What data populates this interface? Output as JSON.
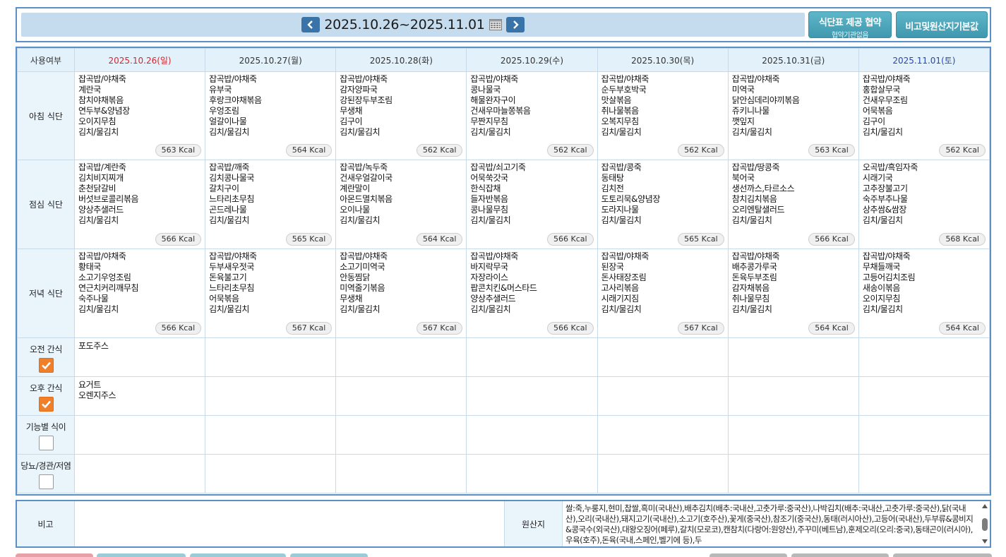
{
  "header": {
    "date_range": "2025.10.26~2025.11.01",
    "prev_label": "previous-week",
    "next_label": "next-week",
    "btn_agreement_main": "식단표 제공 협약",
    "btn_agreement_sub": "협약기관없음",
    "btn_defaults": "비고및원산지기본값"
  },
  "table": {
    "corner_label": "사용여부",
    "days": [
      {
        "label": "2025.10.26(일)",
        "type": "sun"
      },
      {
        "label": "2025.10.27(월)",
        "type": "weekday"
      },
      {
        "label": "2025.10.28(화)",
        "type": "weekday"
      },
      {
        "label": "2025.10.29(수)",
        "type": "weekday"
      },
      {
        "label": "2025.10.30(목)",
        "type": "weekday"
      },
      {
        "label": "2025.10.31(금)",
        "type": "weekday"
      },
      {
        "label": "2025.11.01(토)",
        "type": "sat"
      }
    ],
    "meals": [
      {
        "label": "아침 식단",
        "cells": [
          {
            "items": [
              "잡곡밥/야채죽",
              "계란국",
              "참치야채볶음",
              "연두부&양념장",
              "오이지무침",
              "김치/물김치"
            ],
            "kcal": "563 Kcal"
          },
          {
            "items": [
              "잡곡밥/야채죽",
              "유부국",
              "후랑크야채볶음",
              "우엉조림",
              "얼갈이나물",
              "김치/물김치"
            ],
            "kcal": "564 Kcal"
          },
          {
            "items": [
              "잡곡밥/야채죽",
              "감자양파국",
              "강된장두부조림",
              "무생채",
              "김구이",
              "김치/물김치"
            ],
            "kcal": "562 Kcal"
          },
          {
            "items": [
              "잡곡밥/야채죽",
              "콩나물국",
              "해물완자구이",
              "건새우마늘쫑볶음",
              "무짠지무침",
              "김치/물김치"
            ],
            "kcal": "562 Kcal"
          },
          {
            "items": [
              "잡곡밥/야채죽",
              "순두부호박국",
              "맛살볶음",
              "취나물볶음",
              "오복지무침",
              "김치/물김치"
            ],
            "kcal": "562 Kcal"
          },
          {
            "items": [
              "잡곡밥/야채죽",
              "미역국",
              "닭안심데리야끼볶음",
              "쥬키니나물",
              "깻잎지",
              "김치/물김치"
            ],
            "kcal": "563 Kcal"
          },
          {
            "items": [
              "잡곡밥/야채죽",
              "홍합살무국",
              "건새우무조림",
              "어묵볶음",
              "김구이",
              "김치/물김치"
            ],
            "kcal": "562 Kcal"
          }
        ]
      },
      {
        "label": "점심 식단",
        "cells": [
          {
            "items": [
              "잡곡밥/계란죽",
              "김치비지찌개",
              "춘천닭갈비",
              "버섯브로콜리볶음",
              "양상추샐러드",
              "김치/물김치"
            ],
            "kcal": "566 Kcal"
          },
          {
            "items": [
              "잡곡밥/깨죽",
              "김치콩나물국",
              "갈치구이",
              "느타리초무침",
              "곤드레나물",
              "김치/물김치"
            ],
            "kcal": "565 Kcal"
          },
          {
            "items": [
              "잡곡밥/녹두죽",
              "건새우얼갈이국",
              "계란말이",
              "아몬드멸치볶음",
              "오이나물",
              "김치/물김치"
            ],
            "kcal": "564 Kcal"
          },
          {
            "items": [
              "잡곡밥/쇠고기죽",
              "어묵쑥갓국",
              "한식잡채",
              "들자반볶음",
              "콩나물무침",
              "김치/물김치"
            ],
            "kcal": "566 Kcal"
          },
          {
            "items": [
              "잡곡밥/콩죽",
              "동태탕",
              "김치전",
              "도토리묵&양념장",
              "도라지나물",
              "김치/물김치"
            ],
            "kcal": "565 Kcal"
          },
          {
            "items": [
              "잡곡밥/땅콩죽",
              "북어국",
              "생선까스,타르소스",
              "참치김치볶음",
              "오리엔탈샐러드",
              "김치/물김치"
            ],
            "kcal": "566 Kcal"
          },
          {
            "items": [
              "오곡밥/흑임자죽",
              "시래기국",
              "고추장불고기",
              "숙주부추나물",
              "상추쌈&쌈장",
              "김치/물김치"
            ],
            "kcal": "568 Kcal"
          }
        ]
      },
      {
        "label": "저녁 식단",
        "cells": [
          {
            "items": [
              "잡곡밥/야채죽",
              "황태국",
              "소고기우엉조림",
              "연근치커리깨무침",
              "숙주나물",
              "김치/물김치"
            ],
            "kcal": "566 Kcal"
          },
          {
            "items": [
              "잡곡밥/야채죽",
              "두부새우젓국",
              "돈육불고기",
              "느타리초무침",
              "어묵볶음",
              "김치/물김치"
            ],
            "kcal": "567 Kcal"
          },
          {
            "items": [
              "잡곡밥/야채죽",
              "소고기미역국",
              "안동찜닭",
              "미역줄기볶음",
              "무생채",
              "김치/물김치"
            ],
            "kcal": "567 Kcal"
          },
          {
            "items": [
              "잡곡밥/야채죽",
              "바지락무국",
              "자장라이스",
              "팝콘치킨&머스타드",
              "양상추샐러드",
              "김치/물김치"
            ],
            "kcal": "566 Kcal"
          },
          {
            "items": [
              "잡곡밥/야채죽",
              "된장국",
              "돈사태장조림",
              "고사리볶음",
              "시래기지짐",
              "김치/물김치"
            ],
            "kcal": "567 Kcal"
          },
          {
            "items": [
              "잡곡밥/야채죽",
              "배추콩가루국",
              "돈육두부조림",
              "감자채볶음",
              "취나물무침",
              "김치/물김치"
            ],
            "kcal": "564 Kcal"
          },
          {
            "items": [
              "잡곡밥/야채죽",
              "무채들깨국",
              "고등어김치조림",
              "새송이볶음",
              "오이지무침",
              "김치/물김치"
            ],
            "kcal": "564 Kcal"
          }
        ]
      }
    ],
    "snacks": [
      {
        "label": "오전 간식",
        "checked": true,
        "cells": [
          [
            "포도주스"
          ],
          [],
          [],
          [],
          [],
          [],
          []
        ]
      },
      {
        "label": "오후 간식",
        "checked": true,
        "cells": [
          [
            "요거트",
            "오렌지주스"
          ],
          [],
          [],
          [],
          [],
          [],
          []
        ]
      },
      {
        "label": "기능별 식이",
        "checked": false,
        "cells": [
          [],
          [],
          [],
          [],
          [],
          [],
          []
        ]
      },
      {
        "label": "당뇨/경관/저염",
        "checked": false,
        "cells": [
          [],
          [],
          [],
          [],
          [],
          [],
          []
        ]
      }
    ]
  },
  "notes": {
    "remarks_label": "비고",
    "remarks_value": "",
    "origin_label": "원산지",
    "origin_text": "쌀:죽,누룽지,현미,찹쌀,흑미(국내산),배추김치(배추:국내산,고춧가루:중국산),나박김치(배추:국내산,고춧가루:중국산),닭(국내산),오리(국내산),돼지고기(국내산),소고기(호주산),꽃게(중국산),참조기(중국산),동태(러시아산),고등어(국내산),두부류&콩비지&콩국수(외국산),대왕오징어(페루),갈치(모로코),캔참치(다랑어:원양산),주꾸미(베트남),훈제오리(오리:중국),동태곤이(러시아),우육(호주),돈육(국내,스페인,벨기에 등),두"
  },
  "colors": {
    "border": "#5b8fc7",
    "header_bar": "#c5dcee",
    "header_cell": "#e3f1fa",
    "sunday": "#d0282e",
    "saturday": "#2546b8",
    "checkbox_on": "#f07f2a",
    "button": "#4aa6bb"
  }
}
